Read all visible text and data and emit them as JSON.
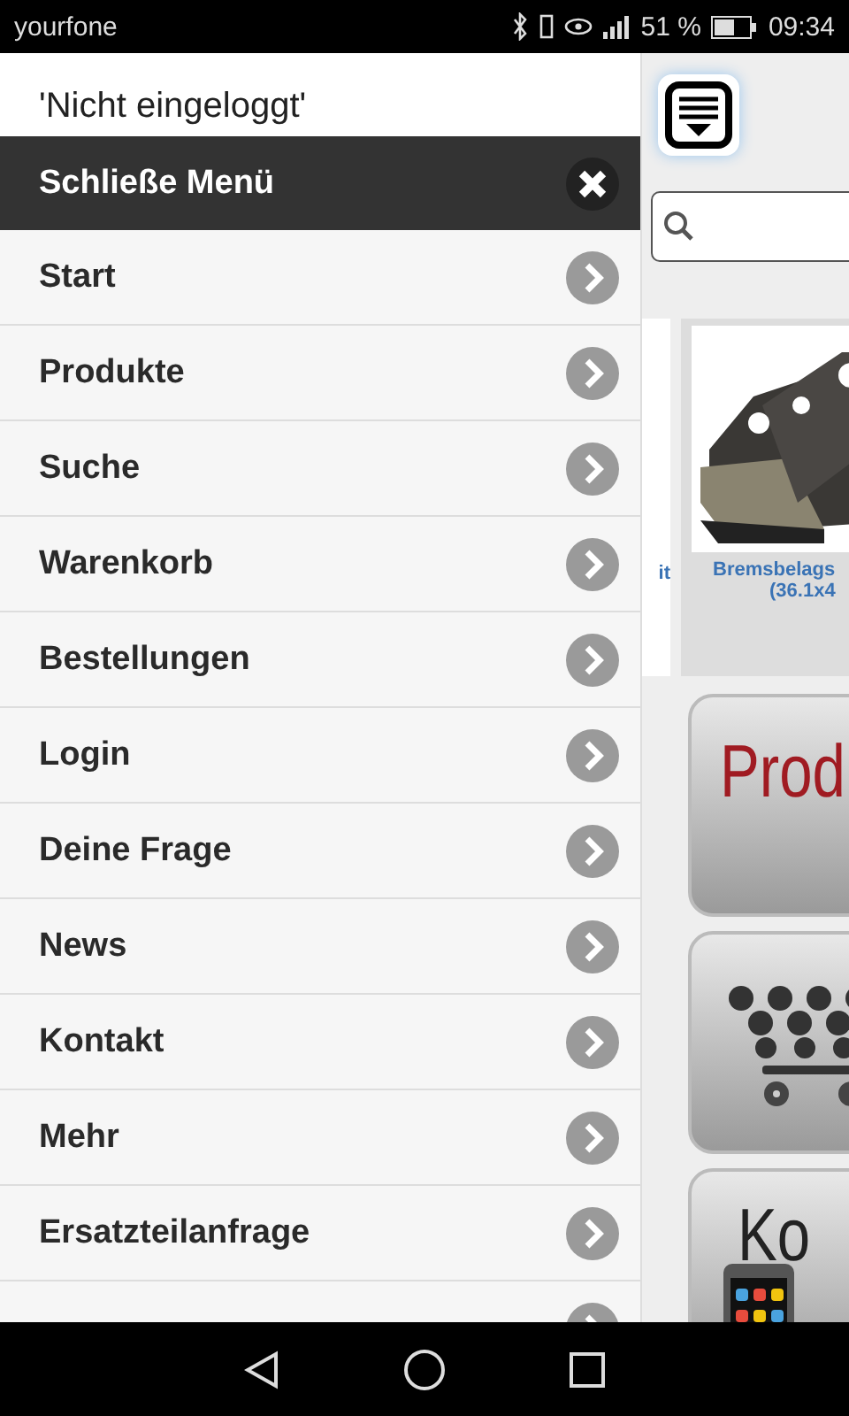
{
  "status_bar": {
    "carrier": "yourfone",
    "battery": "51 %",
    "time": "09:34"
  },
  "drawer": {
    "user": "'Nicht eingeloggt'",
    "close_label": "Schließe Menü",
    "items": [
      {
        "label": "Start"
      },
      {
        "label": "Produkte"
      },
      {
        "label": "Suche"
      },
      {
        "label": "Warenkorb"
      },
      {
        "label": "Bestellungen"
      },
      {
        "label": "Login"
      },
      {
        "label": "Deine Frage"
      },
      {
        "label": "News"
      },
      {
        "label": "Kontakt"
      },
      {
        "label": "Mehr"
      },
      {
        "label": "Ersatzteilanfrage"
      }
    ]
  },
  "page": {
    "previous_product_tail": "it",
    "product": {
      "name": "Bremsbelags",
      "size": "(36.1x4"
    },
    "tiles": [
      {
        "kind": "text",
        "label": "Prod"
      },
      {
        "kind": "cart"
      },
      {
        "kind": "phone",
        "label": "Ko"
      }
    ]
  }
}
